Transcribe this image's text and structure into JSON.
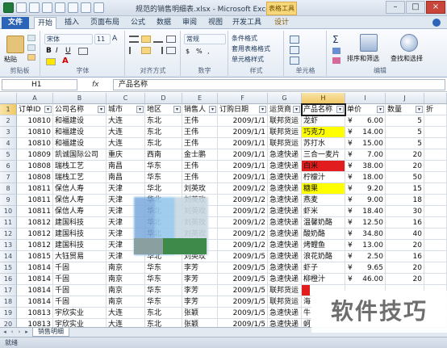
{
  "window": {
    "title": "规范的销售明细表.xlsx - Microsoft Excel",
    "context_tab": "表格工具"
  },
  "ribbon_tabs": [
    "文件",
    "开始",
    "插入",
    "页面布局",
    "公式",
    "数据",
    "审阅",
    "视图",
    "开发工具",
    "设计"
  ],
  "ribbon": {
    "clipboard": {
      "paste": "粘贴",
      "label": "剪贴板"
    },
    "font": {
      "name": "宋体",
      "size": "11",
      "bold": "B",
      "italic": "I",
      "underline": "U",
      "label": "字体"
    },
    "alignment": {
      "label": "对齐方式"
    },
    "number": {
      "format": "常规",
      "label": "数字"
    },
    "styles": {
      "conditional": "条件格式",
      "table": "套用表格格式",
      "cell": "单元格样式",
      "label": "样式"
    },
    "cells": {
      "label": "单元格"
    },
    "editing": {
      "sum": "Σ",
      "sort_filter": "排序和筛选",
      "find_select": "查找和选择",
      "label": "编辑"
    }
  },
  "formula_bar": {
    "name_box": "H1",
    "fx": "fx",
    "formula": "产品名称"
  },
  "columns": [
    "A",
    "B",
    "C",
    "D",
    "E",
    "F",
    "G",
    "H",
    "I",
    "J"
  ],
  "headers": [
    "订单ID",
    "公司名称",
    "城市",
    "地区",
    "销售人",
    "订购日期",
    "运货商",
    "产品名称",
    "单价",
    "数量",
    "折"
  ],
  "rows": [
    {
      "n": "2",
      "id": "10810",
      "company": "和福建设",
      "city": "大连",
      "region": "东北",
      "rep": "王伟",
      "date": "2009/1/1",
      "ship": "联邦货运",
      "product": "龙虾",
      "price": "6.00",
      "qty": "5"
    },
    {
      "n": "3",
      "id": "10810",
      "company": "和福建设",
      "city": "大连",
      "region": "东北",
      "rep": "王伟",
      "date": "2009/1/1",
      "ship": "联邦货运",
      "product": "巧克力",
      "price": "14.00",
      "qty": "5"
    },
    {
      "n": "4",
      "id": "10810",
      "company": "和福建设",
      "city": "大连",
      "region": "东北",
      "rep": "王伟",
      "date": "2009/1/1",
      "ship": "联邦货运",
      "product": "苏打水",
      "price": "15.00",
      "qty": "5"
    },
    {
      "n": "5",
      "id": "10809",
      "company": "凯诚国际公司",
      "city": "重庆",
      "region": "西南",
      "rep": "金士鹏",
      "date": "2009/1/1",
      "ship": "急速快递",
      "product": "三合一麦片",
      "price": "7.00",
      "qty": "20"
    },
    {
      "n": "6",
      "id": "10808",
      "company": "瑞栈工艺",
      "city": "南昌",
      "region": "华东",
      "rep": "王伟",
      "date": "2009/1/1",
      "ship": "急速快递",
      "product": "白米",
      "price": "38.00",
      "qty": "20"
    },
    {
      "n": "7",
      "id": "10808",
      "company": "瑞栈工艺",
      "city": "南昌",
      "region": "华东",
      "rep": "王伟",
      "date": "2009/1/1",
      "ship": "急速快递",
      "product": "柠檬汁",
      "price": "18.00",
      "qty": "50"
    },
    {
      "n": "8",
      "id": "10811",
      "company": "保信人寿",
      "city": "天津",
      "region": "华北",
      "rep": "刘英玫",
      "date": "2009/1/2",
      "ship": "急速快递",
      "product": "糖果",
      "price": "9.20",
      "qty": "15"
    },
    {
      "n": "9",
      "id": "10811",
      "company": "保信人寿",
      "city": "天津",
      "region": "华北",
      "rep": "刘英玫",
      "date": "2009/1/2",
      "ship": "急速快递",
      "product": "燕麦",
      "price": "9.00",
      "qty": "18"
    },
    {
      "n": "10",
      "id": "10811",
      "company": "保信人寿",
      "city": "天津",
      "region": "华北",
      "rep": "刘英玫",
      "date": "2009/1/2",
      "ship": "急速快递",
      "product": "虾米",
      "price": "18.40",
      "qty": "30"
    },
    {
      "n": "11",
      "id": "10812",
      "company": "建国科技",
      "city": "天津",
      "region": "华北",
      "rep": "刘英玫",
      "date": "2009/1/2",
      "ship": "急速快递",
      "product": "温馨奶酪",
      "price": "12.50",
      "qty": "16"
    },
    {
      "n": "12",
      "id": "10812",
      "company": "建国科技",
      "city": "天津",
      "region": "华北",
      "rep": "刘英玫",
      "date": "2009/1/2",
      "ship": "急速快递",
      "product": "酸奶酪",
      "price": "34.80",
      "qty": "40"
    },
    {
      "n": "13",
      "id": "10812",
      "company": "建国科技",
      "city": "天津",
      "region": "华北",
      "rep": "刘英玫",
      "date": "2009/1/2",
      "ship": "急速快递",
      "product": "烤鲤鱼",
      "price": "13.00",
      "qty": "20"
    },
    {
      "n": "14",
      "id": "10815",
      "company": "大钰贸易",
      "city": "天津",
      "region": "华北",
      "rep": "刘英玫",
      "date": "2009/1/5",
      "ship": "急速快递",
      "product": "浪花奶酪",
      "price": "2.50",
      "qty": "16"
    },
    {
      "n": "15",
      "id": "10814",
      "company": "千固",
      "city": "南京",
      "region": "华东",
      "rep": "李芳",
      "date": "2009/1/5",
      "ship": "急速快递",
      "product": "虾子",
      "price": "9.65",
      "qty": "20"
    },
    {
      "n": "16",
      "id": "10814",
      "company": "千固",
      "city": "南京",
      "region": "华东",
      "rep": "李芳",
      "date": "2009/1/5",
      "ship": "急速快递",
      "product": "柳橙汁",
      "price": "46.00",
      "qty": "20"
    },
    {
      "n": "17",
      "id": "10814",
      "company": "千固",
      "city": "南京",
      "region": "华东",
      "rep": "李芳",
      "date": "2009/1/5",
      "ship": "联邦货运",
      "product": "",
      "price": "",
      "qty": ""
    },
    {
      "n": "18",
      "id": "10814",
      "company": "千固",
      "city": "南京",
      "region": "华东",
      "rep": "李芳",
      "date": "2009/1/5",
      "ship": "联邦货运",
      "product": "海",
      "price": "",
      "qty": ""
    },
    {
      "n": "19",
      "id": "10813",
      "company": "宇欣实业",
      "city": "大连",
      "region": "东北",
      "rep": "张颖",
      "date": "2009/1/5",
      "ship": "急速快递",
      "product": "牛",
      "price": "",
      "qty": ""
    },
    {
      "n": "20",
      "id": "10813",
      "company": "宇欣实业",
      "city": "大连",
      "region": "东北",
      "rep": "张颖",
      "date": "2009/1/5",
      "ship": "急速快递",
      "product": "蚵",
      "price": "",
      "qty": ""
    }
  ],
  "highlight_colors": {
    "yellow": "#ffff00",
    "red": "#e21d1d"
  },
  "sheet_tab": "销售明细",
  "status": "就绪",
  "watermark": "软件技巧"
}
